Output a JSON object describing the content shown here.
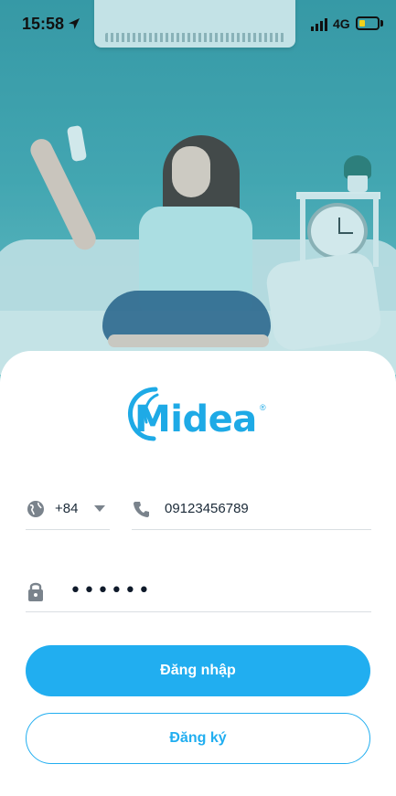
{
  "status_bar": {
    "time": "15:58",
    "network": "4G",
    "battery_color": "#f1d21a"
  },
  "brand": {
    "name": "Midea",
    "registered": "®",
    "color": "#1eaae6"
  },
  "form": {
    "country_code": "+84",
    "phone_value": "09123456789",
    "password_value": "••••••",
    "icons": {
      "country": "globe-icon",
      "phone": "phone-icon",
      "password": "lock-icon",
      "dropdown": "caret-down-icon"
    }
  },
  "actions": {
    "login_label": "Đăng nhập",
    "register_label": "Đăng ký",
    "accent": "#21aef0"
  }
}
